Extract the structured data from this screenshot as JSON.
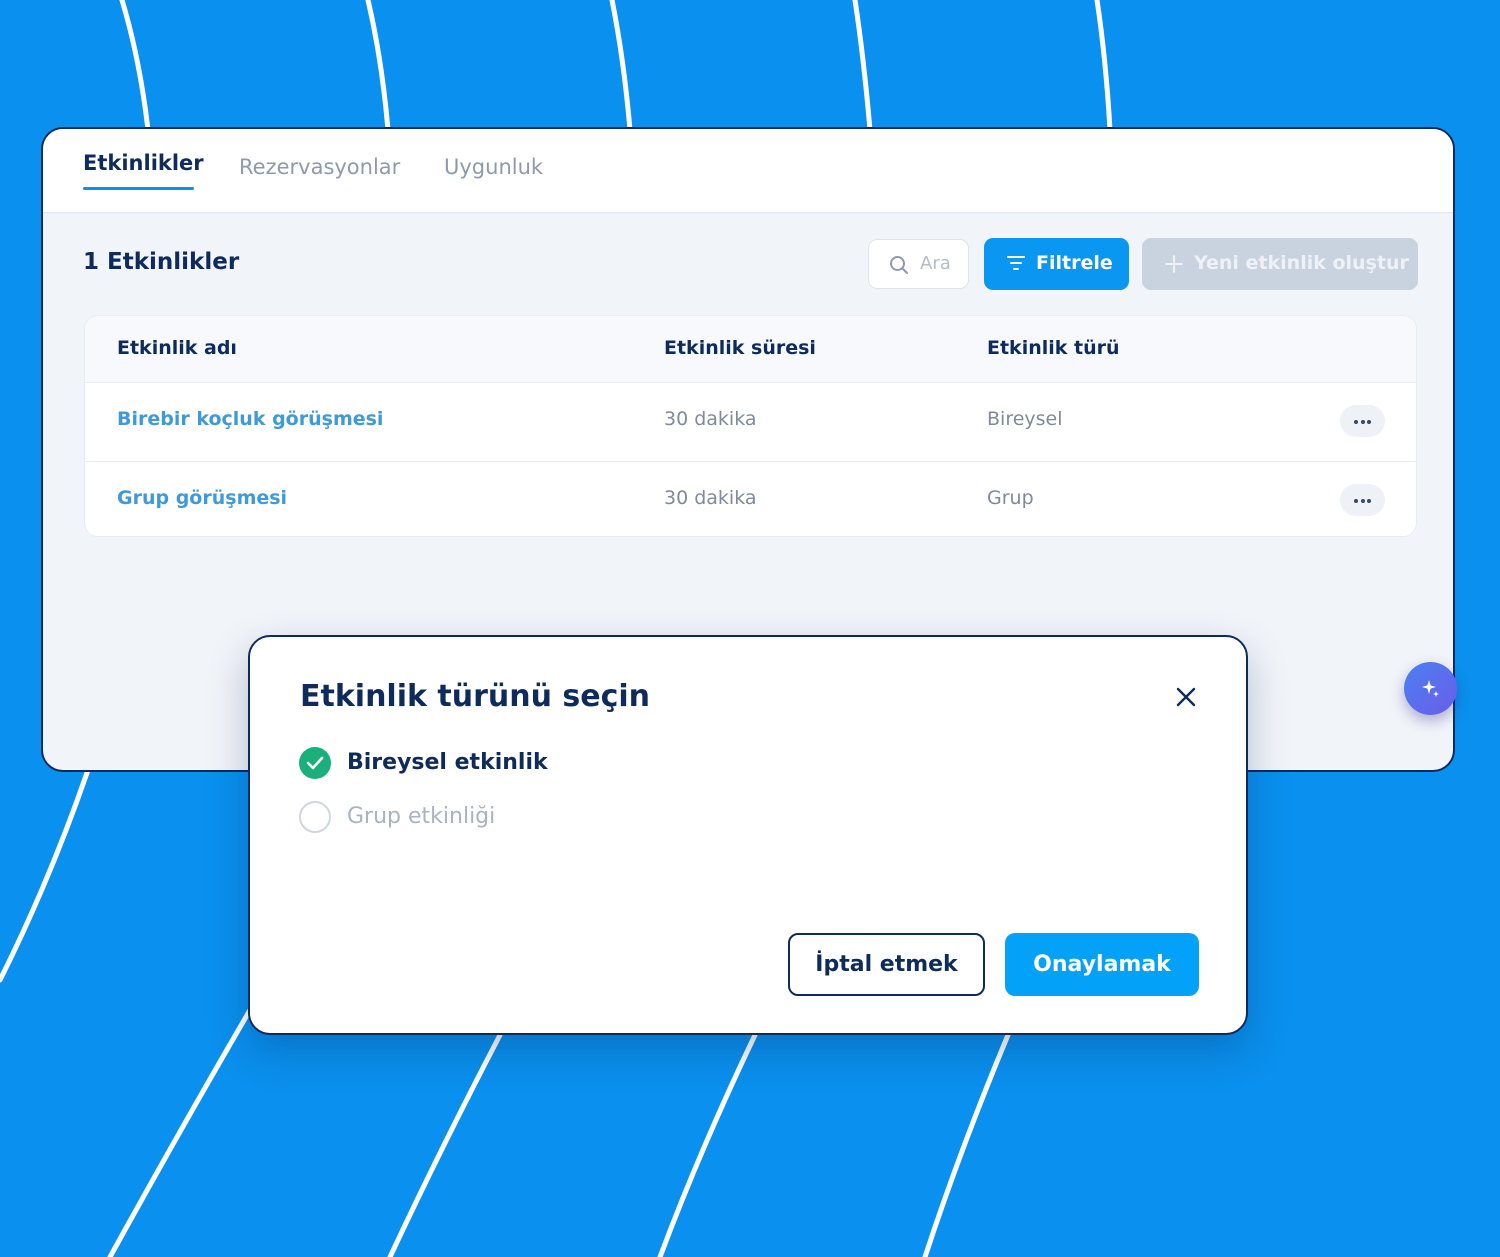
{
  "tabs": [
    {
      "label": "Etkinlikler",
      "active": true
    },
    {
      "label": "Rezervasyonlar",
      "active": false
    },
    {
      "label": "Uygunluk",
      "active": false
    }
  ],
  "toolbar": {
    "count_title": "1 Etkinlikler",
    "search_placeholder": "Ara",
    "filter_label": "Filtrele",
    "new_event_label": "Yeni etkinlik oluştur"
  },
  "table": {
    "columns": [
      "Etkinlik adı",
      "Etkinlik süresi",
      "Etkinlik türü"
    ],
    "rows": [
      {
        "name": "Birebir koçluk görüşmesi",
        "duration": "30 dakika",
        "type": "Bireysel"
      },
      {
        "name": "Grup görüşmesi",
        "duration": "30 dakika",
        "type": "Grup"
      }
    ]
  },
  "modal": {
    "title": "Etkinlik türünü seçin",
    "options": [
      {
        "label": "Bireysel etkinlik",
        "selected": true
      },
      {
        "label": "Grup etkinliği",
        "selected": false
      }
    ],
    "cancel_label": "İptal etmek",
    "confirm_label": "Onaylamak"
  },
  "colors": {
    "background": "#0a90ee",
    "primary": "#0a97f2",
    "navy": "#0f2b5b",
    "success": "#19b07b",
    "link": "#3e9ad9"
  },
  "icons": [
    "search-icon",
    "filter-icon",
    "plus-icon",
    "more-icon",
    "close-icon",
    "check-icon",
    "sparkle-icon"
  ]
}
